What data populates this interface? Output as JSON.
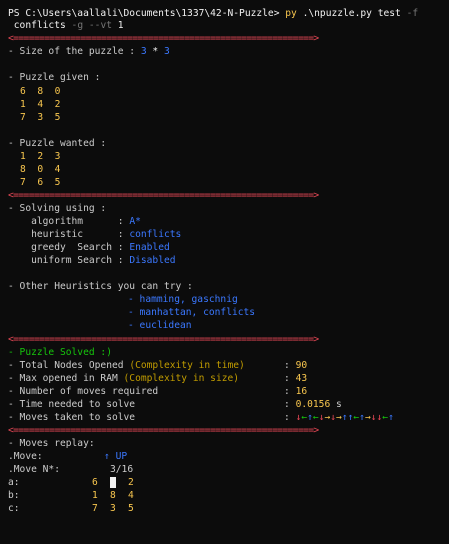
{
  "prompt": {
    "ps": "PS C:\\Users\\aallali\\Documents\\1337\\42-N-Puzzle>",
    "cmd": "py",
    "script": ".\\npuzzle.py",
    "arg_test": "test",
    "flag_f": "-f",
    "arg_conflicts": "conflicts",
    "flag_g": "-g",
    "flag_vt": "--vt",
    "arg_1": "1"
  },
  "separator": "<==========================================================>",
  "size": {
    "label": "- Size of the puzzle :",
    "w": "3",
    "x": "*",
    "h": "3"
  },
  "given": {
    "label": "- Puzzle given :",
    "rows": [
      "6  8  0",
      "1  4  2",
      "7  3  5"
    ]
  },
  "wanted": {
    "label": "- Puzzle wanted :",
    "rows": [
      "1  2  3",
      "8  0  4",
      "7  6  5"
    ]
  },
  "solving": {
    "label": "- Solving using :",
    "algorithm_label": "    algorithm      :",
    "algorithm": "A*",
    "heuristic_label": "    heuristic      :",
    "heuristic": "conflicts",
    "greedy_label": "    greedy  Search :",
    "greedy": "Enabled",
    "uniform_label": "    uniform Search :",
    "uniform": "Disabled"
  },
  "other": {
    "label": "- Other Heuristics you can try :",
    "items": [
      "- hamming, gaschnig",
      "- manhattan, conflicts",
      "- euclidean"
    ]
  },
  "solved": {
    "title": "- Puzzle Solved :)",
    "total_label": "- Total Nodes Opened",
    "total_note": "(Complexity in time)",
    "total_value": "90",
    "maxram_label": "- Max opened in RAM",
    "maxram_note": "(Complexity in size)",
    "maxram_value": "43",
    "moves_label": "- Number of moves required",
    "moves_value": "16",
    "time_label": "- Time needed to solve",
    "time_value": "0.0156",
    "time_unit": "s",
    "taken_label": "- Moves taken to solve",
    "taken_arrows": [
      {
        "g": "↓",
        "c": "#e74856"
      },
      {
        "g": "←",
        "c": "#16c60c"
      },
      {
        "g": "↑",
        "c": "#3b78ff"
      },
      {
        "g": "←",
        "c": "#16c60c"
      },
      {
        "g": "↓",
        "c": "#e74856"
      },
      {
        "g": "→",
        "c": "#f9c74f"
      },
      {
        "g": "↓",
        "c": "#e74856"
      },
      {
        "g": "→",
        "c": "#f9c74f"
      },
      {
        "g": "↑",
        "c": "#3b78ff"
      },
      {
        "g": "↑",
        "c": "#3b78ff"
      },
      {
        "g": "←",
        "c": "#16c60c"
      },
      {
        "g": "↑",
        "c": "#3b78ff"
      },
      {
        "g": "→",
        "c": "#f9c74f"
      },
      {
        "g": "↓",
        "c": "#e74856"
      },
      {
        "g": "↓",
        "c": "#e74856"
      },
      {
        "g": "←",
        "c": "#16c60c"
      },
      {
        "g": "↑",
        "c": "#3b78ff"
      }
    ]
  },
  "replay": {
    "label": "- Moves replay:",
    "move_label": ".Move:",
    "move_arrow": "↑",
    "move_dir": "UP",
    "moven_label": ".Move N*:",
    "moven_value": "3/16",
    "rows": [
      {
        "label": "a:",
        "c1": "6",
        "c2": "",
        "c3": "2"
      },
      {
        "label": "b:",
        "c1": "1",
        "c2": "8",
        "c3": "4"
      },
      {
        "label": "c:",
        "c1": "7",
        "c2": "3",
        "c3": "5"
      }
    ]
  },
  "colors": {
    "background": "#0c0c0c",
    "separator": "#e74856",
    "value_blue": "#3b78ff",
    "number_yellow": "#f9c74f",
    "note_gold": "#c19c00",
    "solved_green": "#16c60c"
  }
}
